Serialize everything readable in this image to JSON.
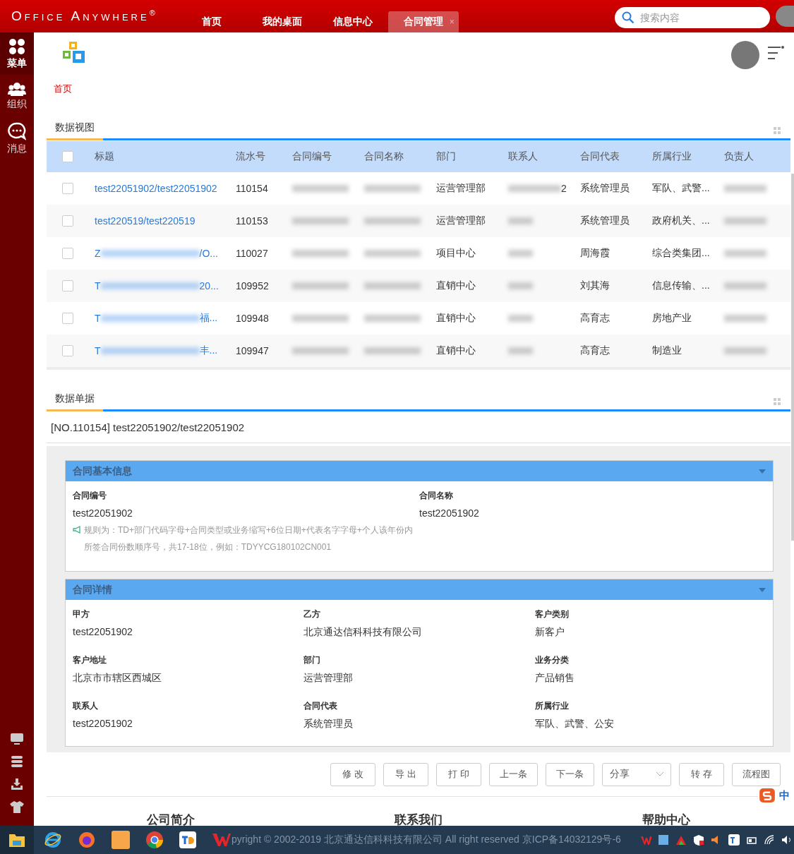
{
  "topbar": {
    "brand": "Office Anywhere$^{®}$",
    "tabs": [
      {
        "label": "首页",
        "selected": false
      },
      {
        "label": "我的桌面",
        "selected": false
      },
      {
        "label": "信息中心",
        "selected": false
      },
      {
        "label": "合同管理",
        "selected": true,
        "close": "×"
      }
    ],
    "search": {
      "placeholder": "搜索内容"
    }
  },
  "sidebar": {
    "items": [
      {
        "label": "菜单",
        "selected": true
      },
      {
        "label": "组织",
        "selected": false
      },
      {
        "label": "消息",
        "selected": false
      }
    ]
  },
  "breadcrumb": "首页",
  "data_view": {
    "title": "数据视图",
    "header_checked": false,
    "columns": [
      "标题",
      "流水号",
      "合同编号",
      "合同名称",
      "部门",
      "联系人",
      "合同代表",
      "所属行业",
      "负责人"
    ],
    "rows": [
      {
        "checked": false,
        "title": [
          "test22051902/test22051902"
        ],
        "serial": "110154",
        "dept": "运营管理部",
        "contact_tail": "2",
        "rep": "系统管理员",
        "industry": "军队、武警..."
      },
      {
        "checked": false,
        "title": [
          "test220519/test220519"
        ],
        "serial": "110153",
        "dept": "运营管理部",
        "rep": "系统管理员",
        "industry": "政府机关、..."
      },
      {
        "checked": false,
        "title": [
          "Z",
          "/O..."
        ],
        "serial": "110027",
        "dept": "项目中心",
        "rep": "周海霞",
        "industry": "综合类集团..."
      },
      {
        "checked": false,
        "title": [
          "T",
          "20..."
        ],
        "serial": "109952",
        "dept": "直销中心",
        "rep": "刘其海",
        "industry": "信息传输、..."
      },
      {
        "checked": false,
        "title": [
          "T",
          "福..."
        ],
        "serial": "109948",
        "dept": "直销中心",
        "rep": "高育志",
        "industry": "房地产业"
      },
      {
        "checked": false,
        "title": [
          "T",
          "丰..."
        ],
        "serial": "109947",
        "dept": "直销中心",
        "rep": "高育志",
        "industry": "制造业"
      }
    ]
  },
  "data_record": {
    "title": "数据单据",
    "heading": "[NO.110154] test22051902/test22051902",
    "panels": [
      {
        "title": "合同基本信息",
        "expanded": true,
        "fields": [
          {
            "label": "合同编号",
            "value": "test22051902",
            "hint": "规则为：TD+部门代码字母+合同类型或业务缩写+6位日期+代表名字字母+个人该年份内所签合同份数顺序号，共17-18位，例如：TDYYCG180102CN001"
          },
          {
            "label": "合同名称",
            "value": "test22051902"
          }
        ]
      },
      {
        "title": "合同详情",
        "expanded": true,
        "fields": [
          {
            "label": "甲方",
            "value": "test22051902"
          },
          {
            "label": "乙方",
            "value": "北京通达信科科技有限公司"
          },
          {
            "label": "客户类别",
            "value": "新客户"
          },
          {
            "label": "客户地址",
            "value": "北京市市辖区西城区"
          },
          {
            "label": "部门",
            "value": "运营管理部"
          },
          {
            "label": "业务分类",
            "value": "产品销售"
          },
          {
            "label": "联系人",
            "value": "test22051902"
          },
          {
            "label": "合同代表",
            "value": "系统管理员"
          },
          {
            "label": "所属行业",
            "value": "军队、武警、公安"
          }
        ]
      }
    ],
    "buttons": [
      {
        "label": "修 改",
        "kind": "button"
      },
      {
        "label": "导 出",
        "kind": "button"
      },
      {
        "label": "打 印",
        "kind": "button"
      },
      {
        "label": "上一条",
        "kind": "button"
      },
      {
        "label": "下一条",
        "kind": "button"
      },
      {
        "label": "分享",
        "kind": "dropdown"
      },
      {
        "label": "转 存",
        "kind": "button"
      },
      {
        "label": "流程图",
        "kind": "button"
      }
    ]
  },
  "ime_indicator": "中",
  "footer": {
    "links": [
      "公司简介",
      "联系我们",
      "帮助中心"
    ]
  },
  "taskbar": {
    "copyright": "pyright © 2002-2019 北京通达信科科技有限公司 All right reserved 京ICP备14032129号-6"
  }
}
